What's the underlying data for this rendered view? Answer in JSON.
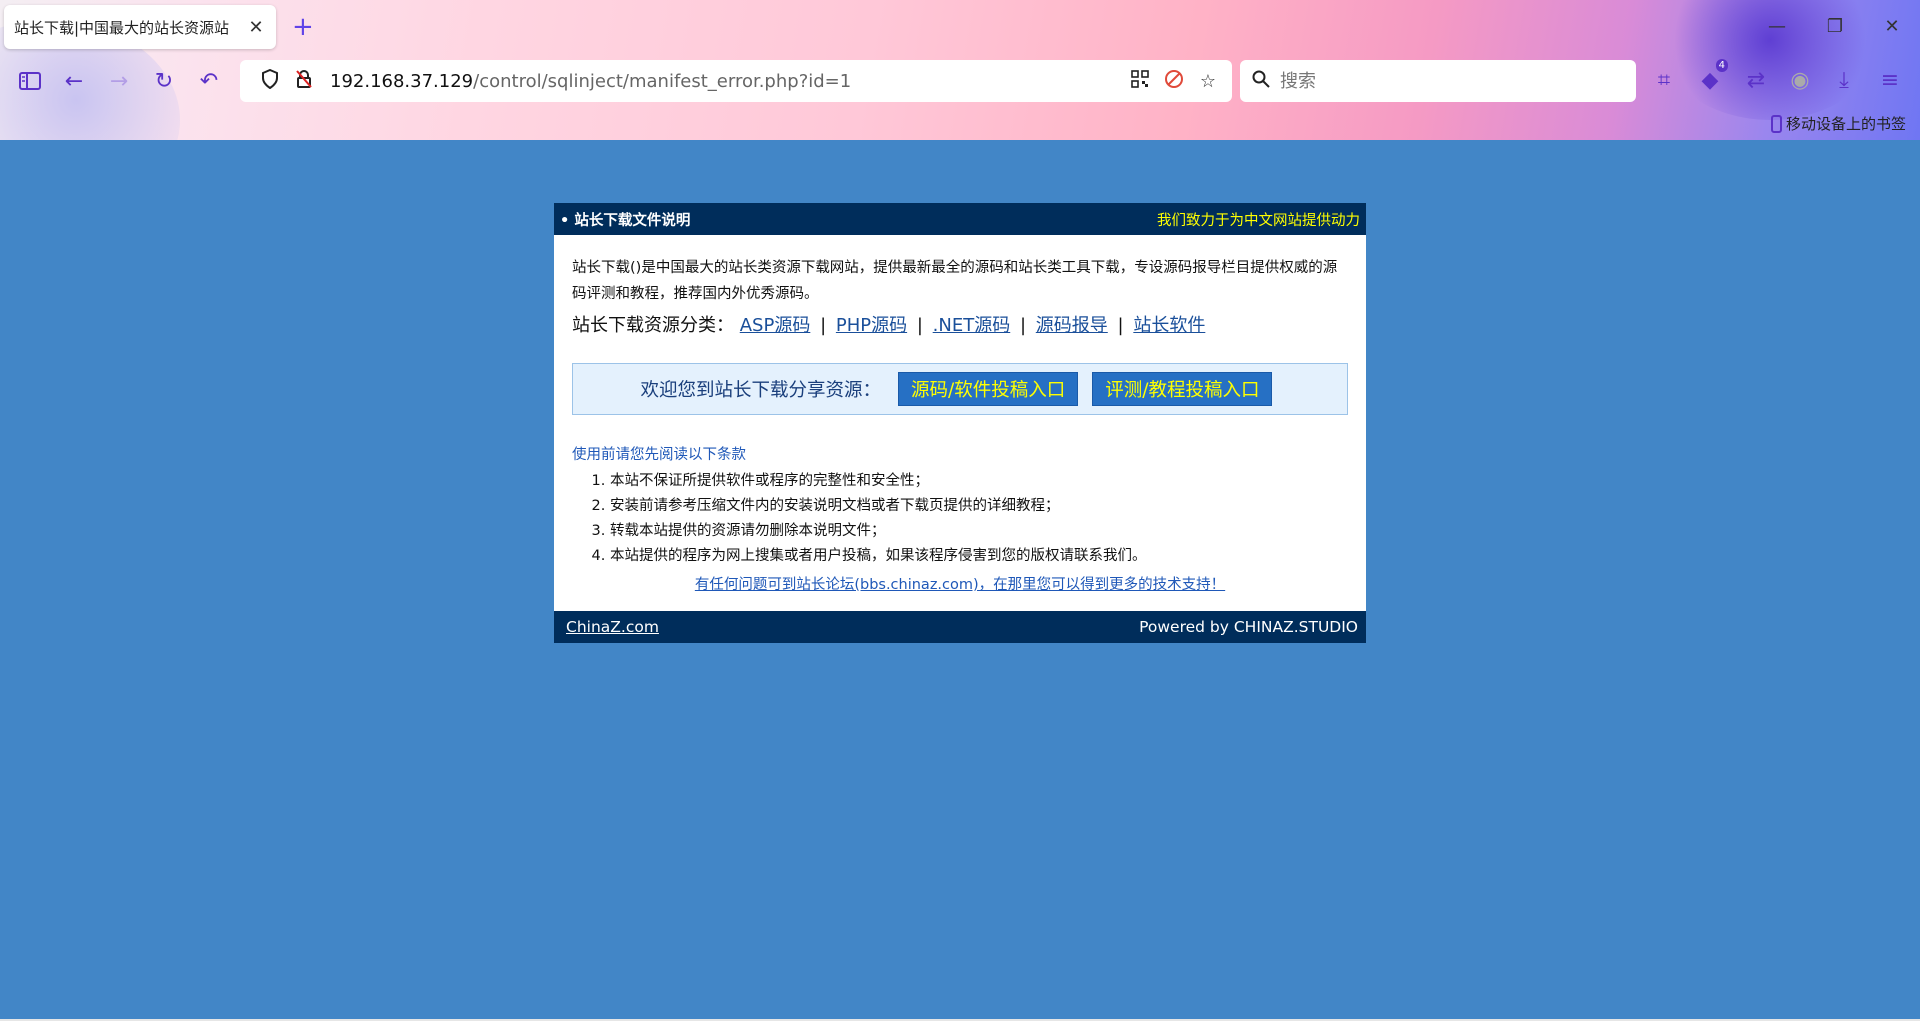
{
  "browser": {
    "tab_title": "站长下载|中国最大的站长资源站",
    "tab_close": "✕",
    "new_tab": "+",
    "win_minimize": "—",
    "win_restore": "❐",
    "win_close": "✕",
    "url_host": "192.168.37.129",
    "url_path": "/control/sqlinject/manifest_error.php?id=1",
    "search_placeholder": "搜索",
    "extension_badge": "4",
    "bookmark_mobile": "移动设备上的书签",
    "accent_color": "#5b32c8"
  },
  "page": {
    "header_title": "• 站长下载文件说明",
    "header_slogan": "我们致力于为中文网站提供动力",
    "intro": "站长下载()是中国最大的站长类资源下载网站，提供最新最全的源码和站长类工具下载，专设源码报导栏目提供权威的源码评测和教程，推荐国内外优秀源码。",
    "categories_label": "站长下载资源分类：",
    "categories": [
      "ASP源码",
      "PHP源码",
      ".NET源码",
      "源码报导",
      "站长软件"
    ],
    "separator": "|",
    "welcome_text": "欢迎您到站长下载分享资源：",
    "btn_source_submit": "源码/软件投稿入口",
    "btn_review_submit": "评测/教程投稿入口",
    "terms_title": "使用前请您先阅读以下条款",
    "terms": [
      "本站不保证所提供软件或程序的完整性和安全性；",
      "安装前请参考压缩文件内的安装说明文档或者下载页提供的详细教程；",
      "转载本站提供的资源请勿删除本说明文件；",
      "本站提供的程序为网上搜集或者用户投稿，如果该程序侵害到您的版权请联系我们。"
    ],
    "forum_link": "有任何问题可到站长论坛(bbs.chinaz.com)，在那里您可以得到更多的技术支持！",
    "footer_left": "ChinaZ.com",
    "footer_right": "Powered by CHINAZ.STUDIO",
    "colors": {
      "background": "#4286c7",
      "header_bg": "#002d5b",
      "slogan": "#ffff00",
      "button_bg": "#2670c4",
      "link": "#1f58b8"
    }
  }
}
